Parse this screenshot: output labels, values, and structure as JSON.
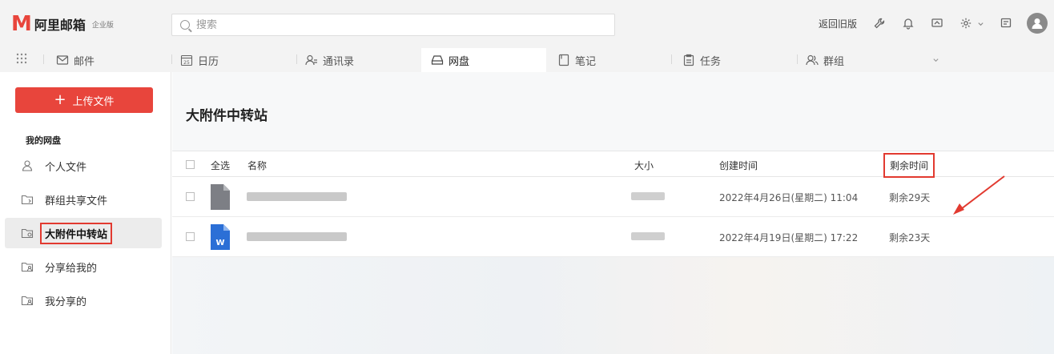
{
  "header": {
    "logo_mark": "M",
    "logo_text": "阿里邮箱",
    "logo_badge": "企业版",
    "search_placeholder": "搜索",
    "back_to_old": "返回旧版"
  },
  "nav": {
    "tabs": [
      {
        "label": "邮件",
        "icon": "mail-icon"
      },
      {
        "label": "日历",
        "icon": "calendar-icon"
      },
      {
        "label": "通讯录",
        "icon": "contacts-icon"
      },
      {
        "label": "网盘",
        "icon": "drive-icon",
        "active": true
      },
      {
        "label": "笔记",
        "icon": "note-icon"
      },
      {
        "label": "任务",
        "icon": "task-icon"
      },
      {
        "label": "群组",
        "icon": "group-icon"
      }
    ],
    "calendar_day": "25"
  },
  "sidebar": {
    "upload_label": "上传文件",
    "section_title": "我的网盘",
    "items": [
      {
        "label": "个人文件",
        "icon": "user-icon"
      },
      {
        "label": "群组共享文件",
        "icon": "folder-share-icon"
      },
      {
        "label": "大附件中转站",
        "icon": "folder-transfer-icon",
        "active": true,
        "highlighted": true
      },
      {
        "label": "分享给我的",
        "icon": "folder-shared-with-me-icon"
      },
      {
        "label": "我分享的",
        "icon": "folder-my-shares-icon"
      }
    ]
  },
  "main": {
    "title": "大附件中转站",
    "columns": {
      "select_all": "全选",
      "name": "名称",
      "size": "大小",
      "created": "创建时间",
      "remaining": "剩余时间"
    },
    "rows": [
      {
        "file_type": "generic-file-icon",
        "created": "2022年4月26日(星期二) 11:04",
        "remaining": "剩余29天"
      },
      {
        "file_type": "word-file-icon",
        "icon_letter": "W",
        "created": "2022年4月19日(星期二) 17:22",
        "remaining": "剩余23天"
      }
    ]
  },
  "colors": {
    "accent": "#e8453c",
    "annotation": "#e23a30",
    "word_blue": "#2b6fd6"
  }
}
